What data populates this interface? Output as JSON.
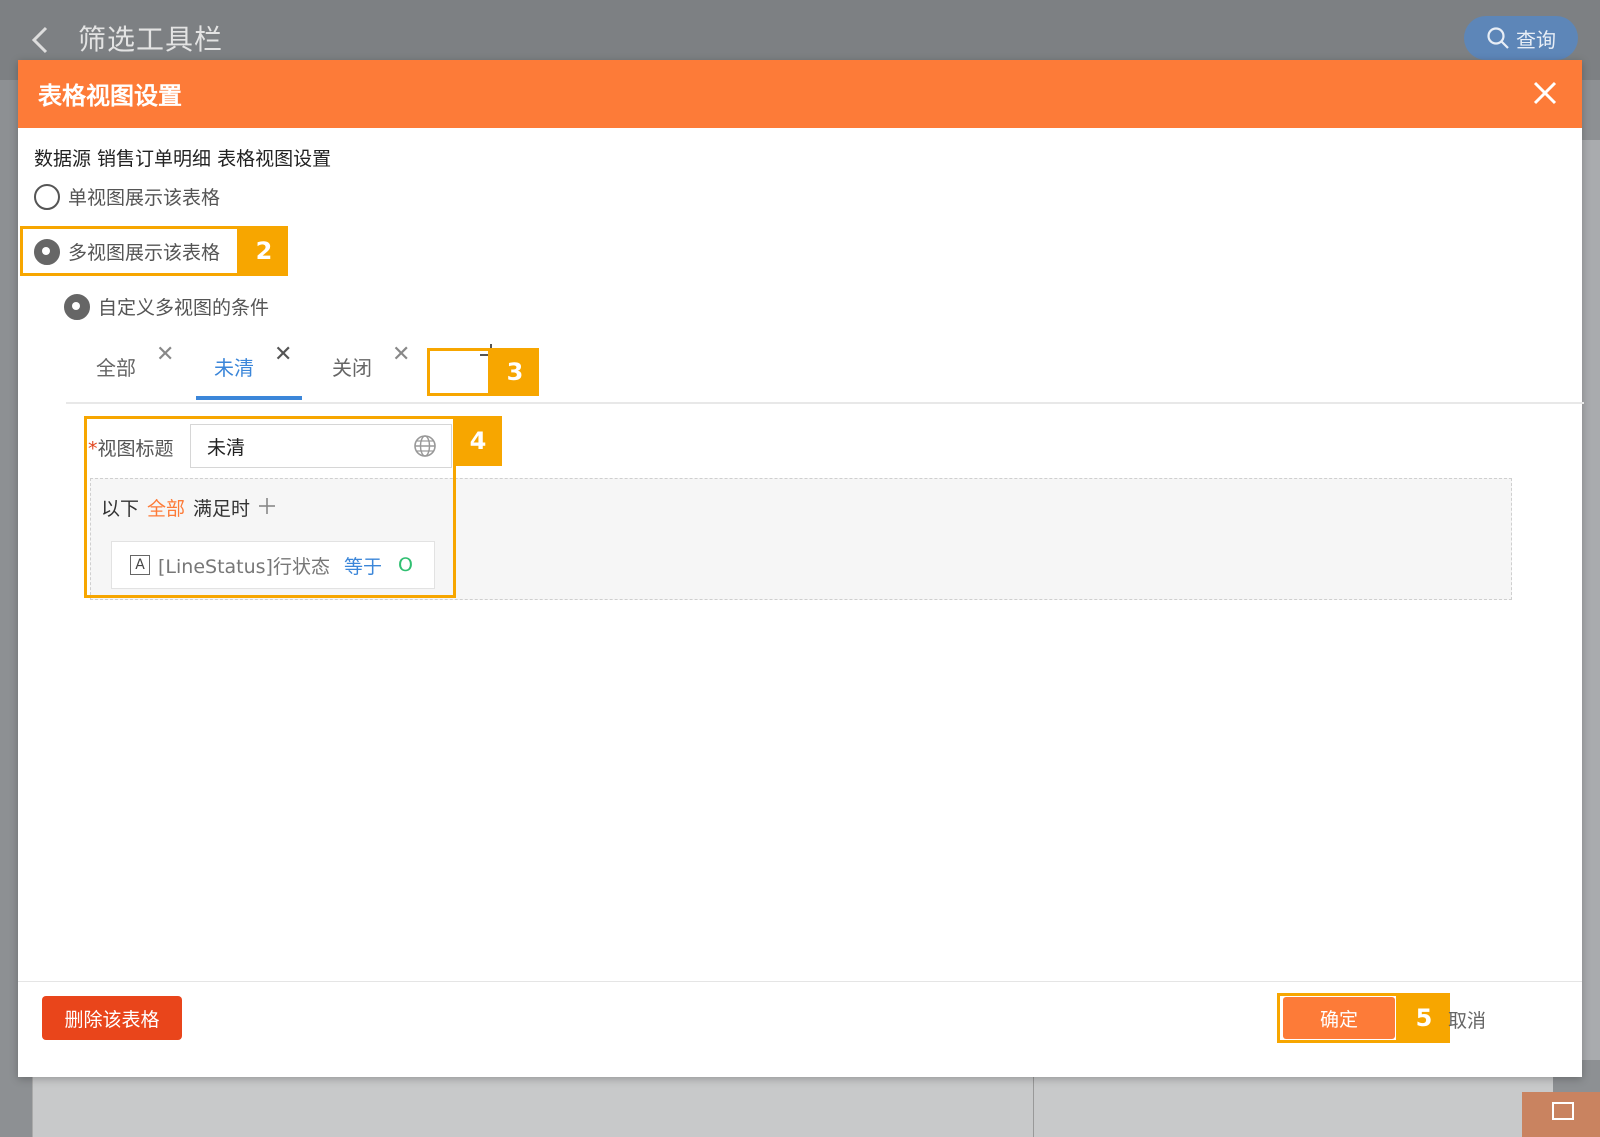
{
  "background": {
    "back_icon": "chevron-left-icon",
    "title": "筛选工具栏",
    "search_label": "查询"
  },
  "modal": {
    "title": "表格视图设置",
    "datasource_label": "数据源 销售订单明细 表格视图设置",
    "radio_single": "单视图展示该表格",
    "radio_multi": "多视图展示该表格",
    "radio_custom": "自定义多视图的条件",
    "tabs": [
      {
        "label": "全部",
        "active": false
      },
      {
        "label": "未清",
        "active": true
      },
      {
        "label": "关闭",
        "active": false
      }
    ],
    "view_title_label": "视图标题",
    "required_mark": "*",
    "view_title_value": "未清",
    "condition": {
      "prefix": "以下",
      "scope": "全部",
      "suffix": "满足时",
      "icon_letter": "A",
      "field": "[LineStatus]行状态",
      "operator": "等于",
      "value": "O"
    },
    "delete_button": "删除该表格",
    "ok_button": "确定",
    "cancel_button": "取消"
  },
  "annotations": {
    "step2": "2",
    "step3": "3",
    "step4": "4",
    "step5": "5"
  },
  "colors": {
    "accent_orange": "#fd7b38",
    "highlight": "#f7a600",
    "active_blue": "#3b86d9",
    "danger": "#e9451b"
  }
}
